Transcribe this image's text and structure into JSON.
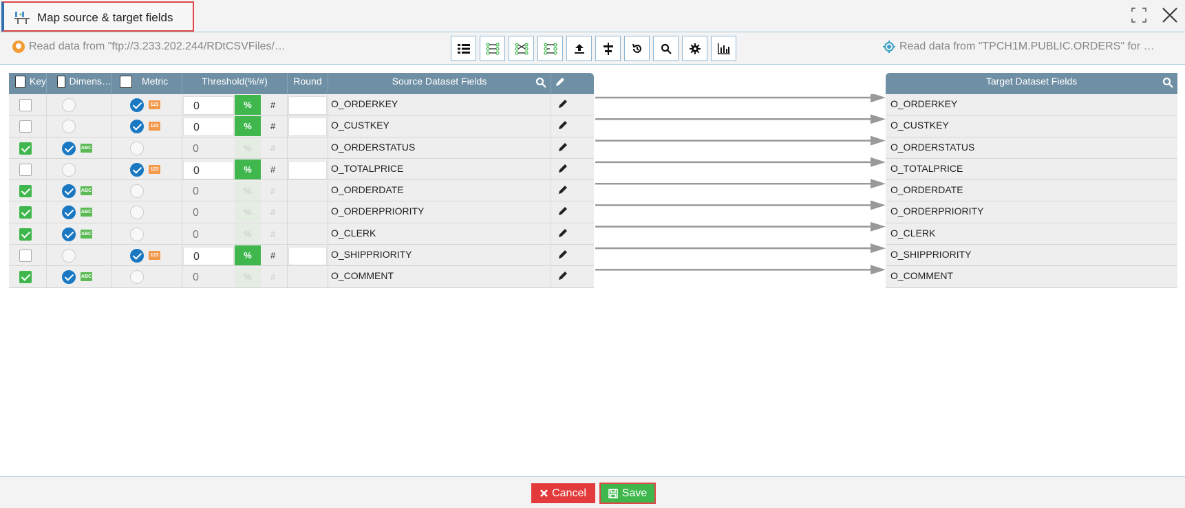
{
  "dialog": {
    "title": "Map source & target fields",
    "source_info": "Read data from \"ftp://3.233.202.244/RDtCSVFiles/…",
    "target_info": "Read data from \"TPCH1M.PUBLIC.ORDERS\" for …"
  },
  "toolbar": {
    "buttons": [
      "list-view-icon",
      "map-all-icon",
      "map-selected-icon",
      "auto-map-icon",
      "upload-icon",
      "align-icon",
      "reset-icon",
      "search-icon",
      "settings-icon",
      "chart-icon"
    ]
  },
  "source_table": {
    "headers": {
      "key": "Key",
      "dimension": "Dimens…",
      "metric": "Metric",
      "threshold": "Threshold(%/#)",
      "round": "Round",
      "source": "Source Dataset Fields"
    },
    "rows": [
      {
        "name": "O_ORDERKEY",
        "key": false,
        "dimension": false,
        "metric": true,
        "threshold": "0",
        "type": "123"
      },
      {
        "name": "O_CUSTKEY",
        "key": false,
        "dimension": false,
        "metric": true,
        "threshold": "0",
        "type": "123"
      },
      {
        "name": "O_ORDERSTATUS",
        "key": true,
        "dimension": true,
        "metric": false,
        "threshold": "0",
        "type": "ABC"
      },
      {
        "name": "O_TOTALPRICE",
        "key": false,
        "dimension": false,
        "metric": true,
        "threshold": "0",
        "type": "123"
      },
      {
        "name": "O_ORDERDATE",
        "key": true,
        "dimension": true,
        "metric": false,
        "threshold": "0",
        "type": "ABC"
      },
      {
        "name": "O_ORDERPRIORITY",
        "key": true,
        "dimension": true,
        "metric": false,
        "threshold": "0",
        "type": "ABC"
      },
      {
        "name": "O_CLERK",
        "key": true,
        "dimension": true,
        "metric": false,
        "threshold": "0",
        "type": "ABC"
      },
      {
        "name": "O_SHIPPRIORITY",
        "key": false,
        "dimension": false,
        "metric": true,
        "threshold": "0",
        "type": "123"
      },
      {
        "name": "O_COMMENT",
        "key": true,
        "dimension": true,
        "metric": false,
        "threshold": "0",
        "type": "ABC"
      }
    ],
    "pct_label": "%",
    "hash_label": "#"
  },
  "target_table": {
    "header": "Target Dataset Fields",
    "rows": [
      "O_ORDERKEY",
      "O_CUSTKEY",
      "O_ORDERSTATUS",
      "O_TOTALPRICE",
      "O_ORDERDATE",
      "O_ORDERPRIORITY",
      "O_CLERK",
      "O_SHIPPRIORITY",
      "O_COMMENT"
    ]
  },
  "footer": {
    "cancel_label": "Cancel",
    "save_label": "Save"
  },
  "colors": {
    "header_bg": "#6f8fa5",
    "green": "#3fb74d",
    "blue": "#1a78c2",
    "orange": "#f2994a",
    "red": "#e33b3b"
  }
}
